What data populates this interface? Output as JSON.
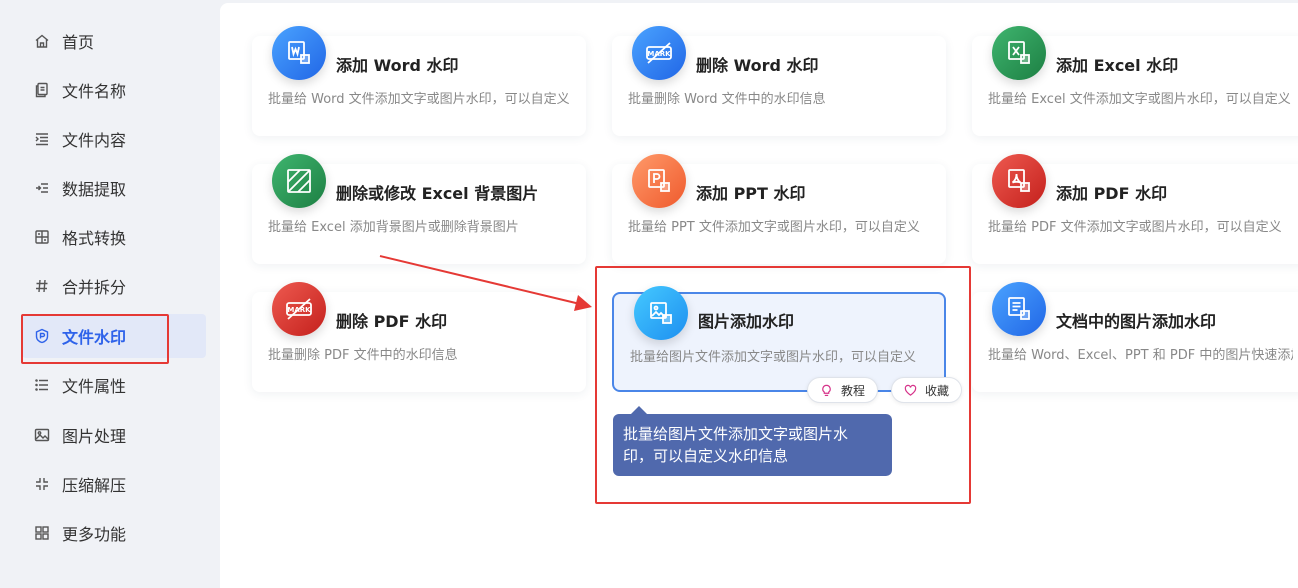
{
  "sidebar": {
    "items": [
      {
        "label": "首页",
        "icon": "home-icon"
      },
      {
        "label": "文件名称",
        "icon": "file-copy-icon"
      },
      {
        "label": "文件内容",
        "icon": "list-indent-icon"
      },
      {
        "label": "数据提取",
        "icon": "extract-icon"
      },
      {
        "label": "格式转换",
        "icon": "convert-icon"
      },
      {
        "label": "合并拆分",
        "icon": "hash-icon"
      },
      {
        "label": "文件水印",
        "icon": "watermark-shield-icon",
        "active": true
      },
      {
        "label": "文件属性",
        "icon": "list-icon"
      },
      {
        "label": "图片处理",
        "icon": "image-icon"
      },
      {
        "label": "压缩解压",
        "icon": "compress-icon"
      },
      {
        "label": "更多功能",
        "icon": "grid-icon"
      }
    ]
  },
  "cards": [
    {
      "title": "添加 Word 水印",
      "desc": "批量给 Word 文件添加文字或图片水印，可以自定义",
      "color": "#2b74ee",
      "icon": "word-watermark-icon"
    },
    {
      "title": "删除 Word 水印",
      "desc": "批量删除 Word 文件中的水印信息",
      "color": "#2b74ee",
      "icon": "mark-remove-icon"
    },
    {
      "title": "添加 Excel 水印",
      "desc": "批量给 Excel 文件添加文字或图片水印，可以自定义",
      "color": "#27944f",
      "icon": "excel-watermark-icon"
    },
    {
      "title": "删除或修改 Excel 背景图片",
      "desc": "批量给 Excel 添加背景图片或删除背景图片",
      "color": "#27944f",
      "icon": "excel-background-icon"
    },
    {
      "title": "添加 PPT 水印",
      "desc": "批量给 PPT 文件添加文字或图片水印，可以自定义",
      "color": "#f26a3c",
      "icon": "ppt-watermark-icon"
    },
    {
      "title": "添加 PDF 水印",
      "desc": "批量给 PDF 文件添加文字或图片水印，可以自定义",
      "color": "#d42d26",
      "icon": "pdf-watermark-icon"
    },
    {
      "title": "删除 PDF 水印",
      "desc": "批量删除 PDF 文件中的水印信息",
      "color": "#d42d26",
      "icon": "mark-remove-icon"
    },
    {
      "title": "图片添加水印",
      "desc": "批量给图片文件添加文字或图片水印，可以自定义",
      "color": "#26a4f5",
      "icon": "image-watermark-icon",
      "selected": true
    },
    {
      "title": "文档中的图片添加水印",
      "desc": "批量给 Word、Excel、PPT 和 PDF 中的图片快速添加",
      "color": "#2b74ee",
      "icon": "doc-image-watermark-icon"
    }
  ],
  "actions": {
    "tutorial": "教程",
    "favorite": "收藏"
  },
  "tooltip": {
    "line1": "批量给图片文件添加文字或图片水",
    "line2": "印，可以自定义水印信息"
  },
  "colors": {
    "accent": "#2f63ea",
    "annotation": "#e53935",
    "tooltip_bg": "#5069ad",
    "selected_border": "#4a86e8"
  }
}
